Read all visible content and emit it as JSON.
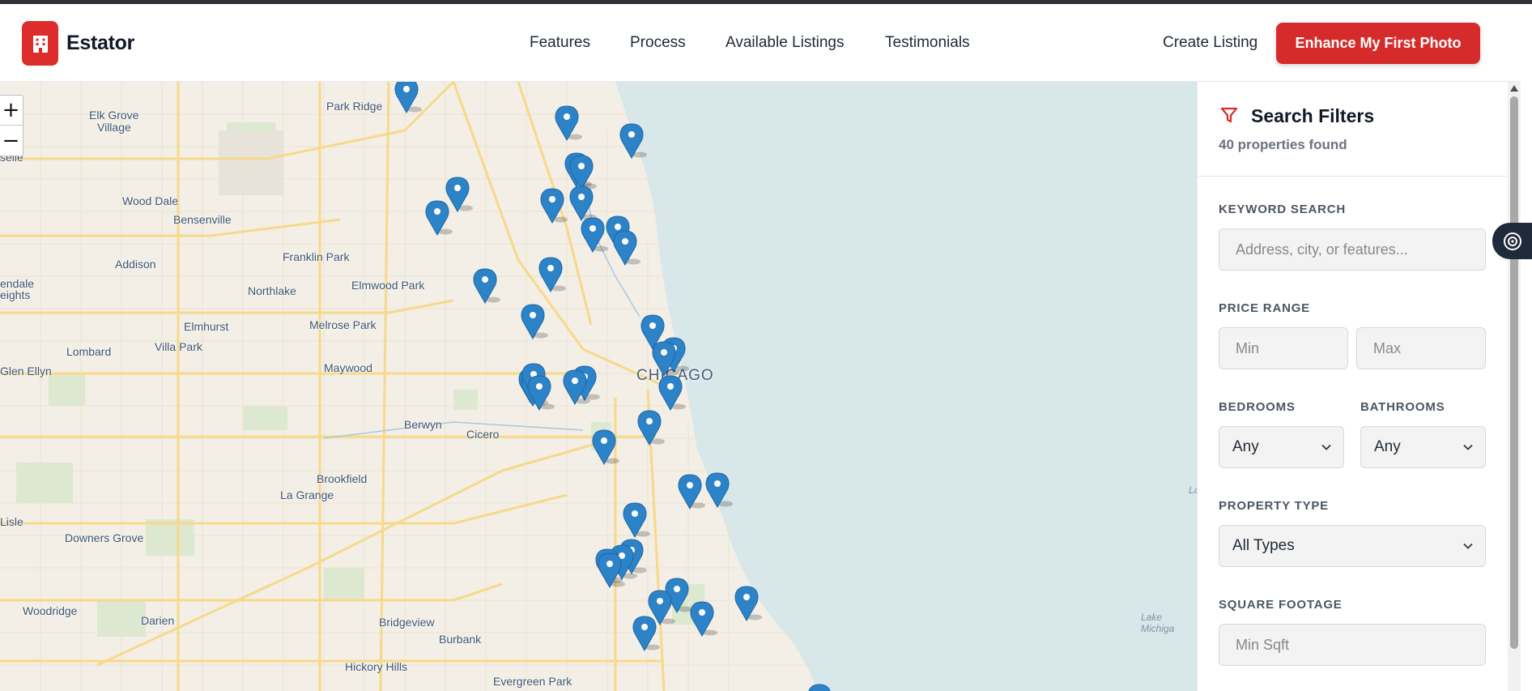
{
  "header": {
    "brand": "Estator",
    "nav": [
      "Features",
      "Process",
      "Available Listings",
      "Testimonials"
    ],
    "create_listing": "Create Listing",
    "cta": "Enhance My First Photo"
  },
  "map": {
    "zoom_in": "+",
    "zoom_out": "−",
    "places": [
      "Park Ridge",
      "Elk Grove",
      "Village",
      "Wood Dale",
      "Bensenville",
      "Addison",
      "Franklin Park",
      "Northlake",
      "Elmwood Park",
      "Melrose Park",
      "Elmhurst",
      "Villa Park",
      "Lombard",
      "Glen Ellyn",
      "Maywood",
      "Berwyn",
      "Cicero",
      "Brookfield",
      "La Grange",
      "Downers Grove",
      "Woodridge",
      "Darien",
      "Bridgeview",
      "Burbank",
      "Hickory Hills",
      "Evergreen Park",
      "endale",
      "eights",
      "Lisle",
      "selle"
    ],
    "city_label": "CHICAGO",
    "lake_label": "Lake Michiga",
    "lake_label_edge": "La",
    "marker_count": 40
  },
  "filters": {
    "title": "Search Filters",
    "count": "40 properties found",
    "keyword_label": "KEYWORD SEARCH",
    "keyword_placeholder": "Address, city, or features...",
    "price_label": "PRICE RANGE",
    "price_min_placeholder": "Min",
    "price_max_placeholder": "Max",
    "bedrooms_label": "BEDROOMS",
    "bedrooms_value": "Any",
    "bathrooms_label": "BATHROOMS",
    "bathrooms_value": "Any",
    "type_label": "PROPERTY TYPE",
    "type_value": "All Types",
    "sqft_label": "SQUARE FOOTAGE",
    "sqft_placeholder": "Min Sqft"
  },
  "colors": {
    "brand_red": "#dc2c2c",
    "marker_blue": "#2d83c8",
    "water": "#d7e7ea"
  }
}
